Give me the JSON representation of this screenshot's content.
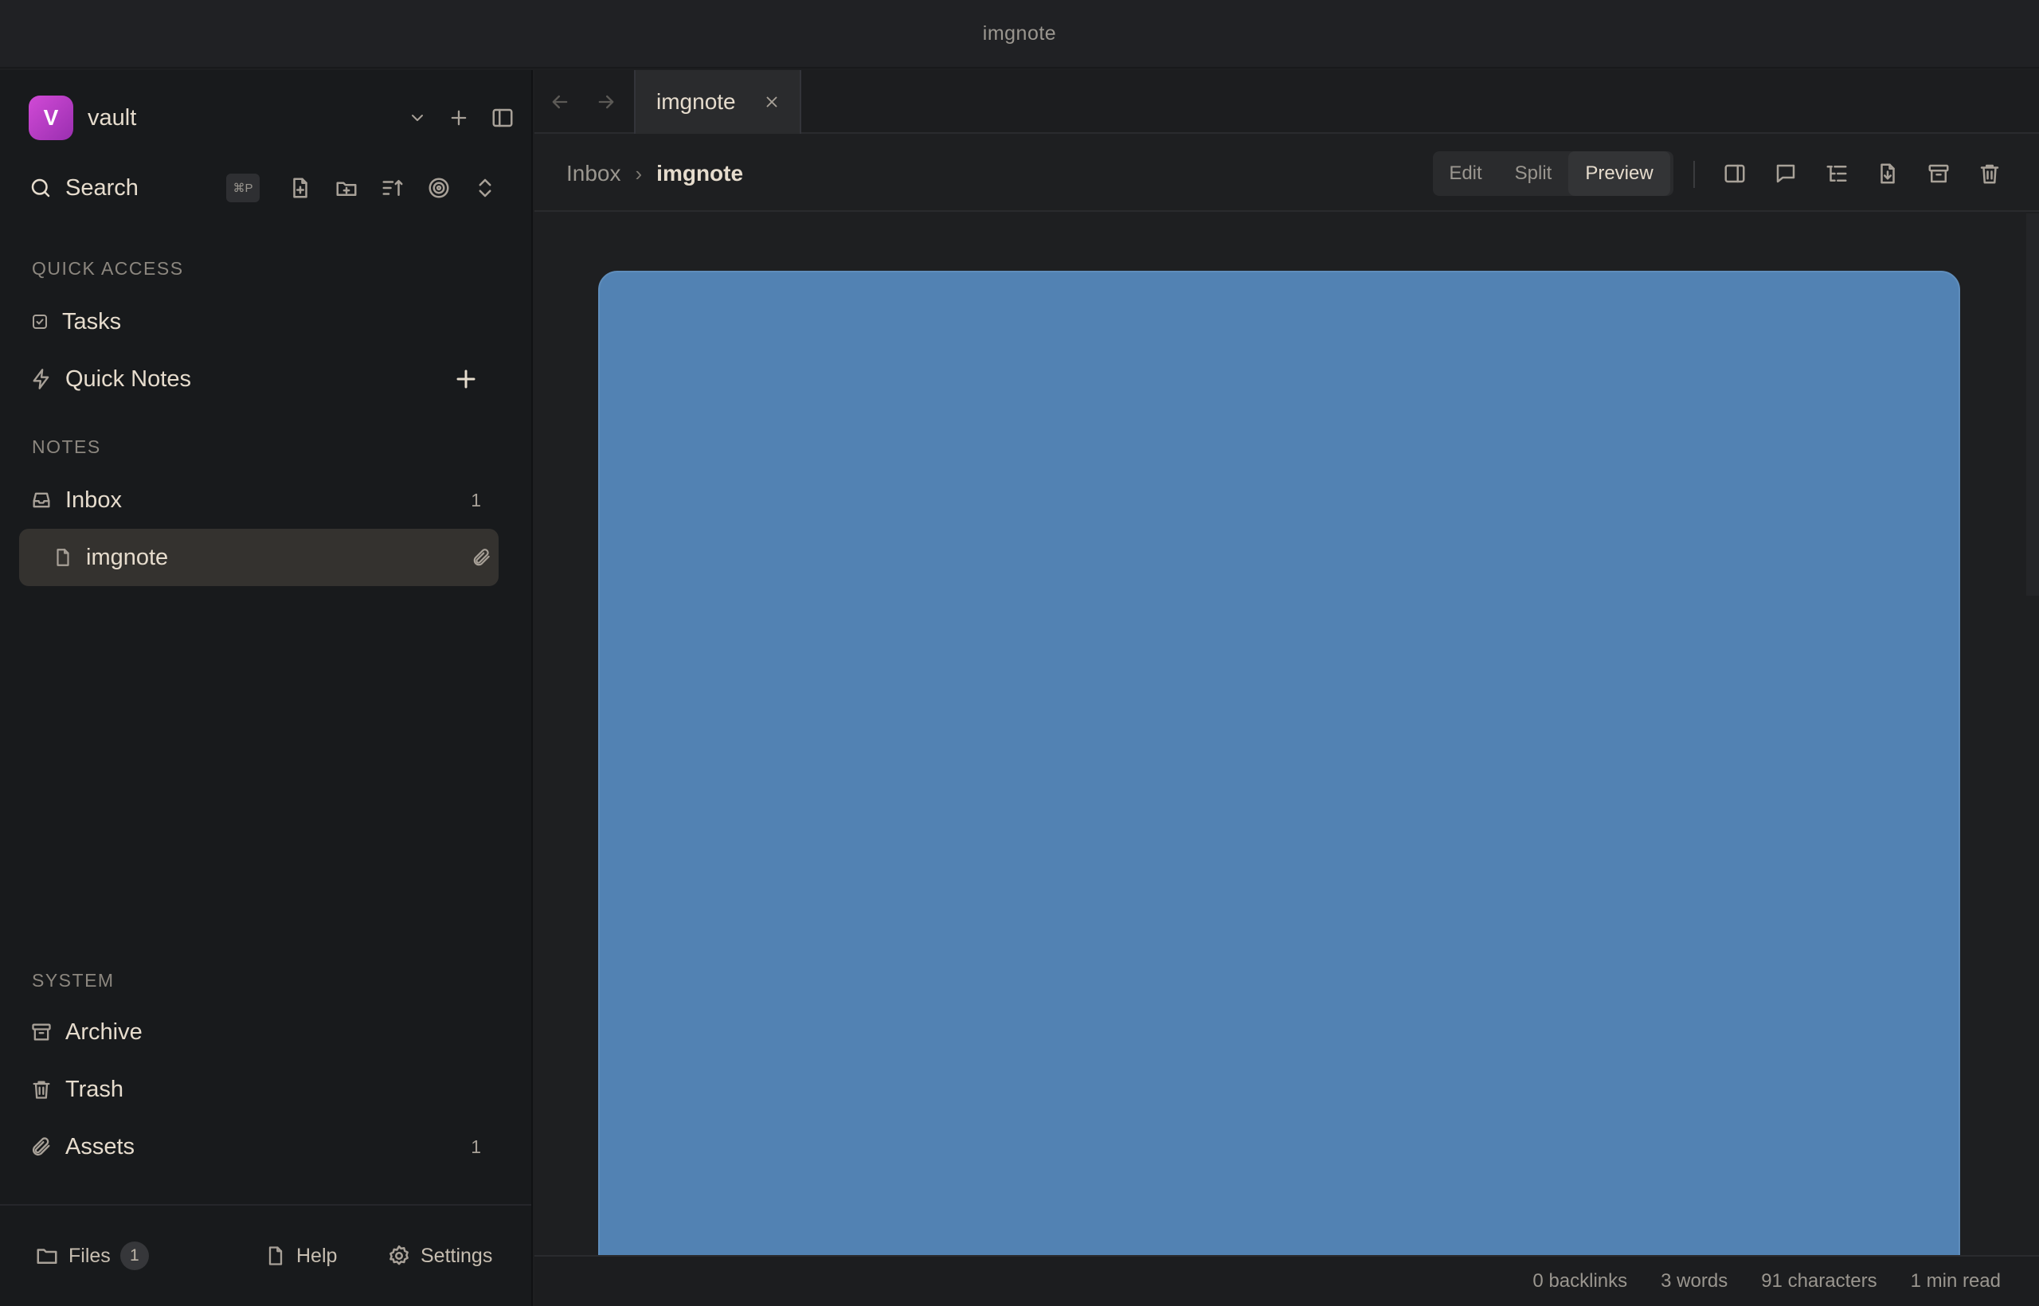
{
  "window": {
    "title": "imgnote"
  },
  "sidebar": {
    "vault": {
      "initial": "V",
      "name": "vault"
    },
    "search": {
      "label": "Search",
      "shortcut": "⌘P"
    },
    "quick_access": {
      "heading": "QUICK ACCESS",
      "items": [
        {
          "label": "Tasks",
          "icon": "checkbox-icon"
        },
        {
          "label": "Quick Notes",
          "icon": "lightning-icon"
        }
      ]
    },
    "notes": {
      "heading": "NOTES",
      "inbox": {
        "label": "Inbox",
        "count": "1"
      },
      "children": [
        {
          "label": "imgnote",
          "active": true
        }
      ]
    },
    "system": {
      "heading": "SYSTEM",
      "items": [
        {
          "label": "Archive",
          "count": ""
        },
        {
          "label": "Trash",
          "count": ""
        },
        {
          "label": "Assets",
          "count": "1"
        }
      ]
    },
    "footer": {
      "files": {
        "label": "Files",
        "count": "1"
      },
      "help": {
        "label": "Help"
      },
      "settings": {
        "label": "Settings"
      }
    }
  },
  "tabs": [
    {
      "label": "imgnote"
    }
  ],
  "breadcrumb": {
    "parent": "Inbox",
    "separator": "›",
    "current": "imgnote"
  },
  "view_modes": {
    "edit": "Edit",
    "split": "Split",
    "preview": "Preview",
    "selected": "Preview"
  },
  "content": {
    "image_color": "#5282b3"
  },
  "status": {
    "backlinks": "0 backlinks",
    "words": "3 words",
    "characters": "91 characters",
    "read_time": "1 min read"
  },
  "colors": {
    "accent_avatar": "#c23fcf",
    "background": "#1e1f21",
    "sidebar": "#181a1c"
  }
}
